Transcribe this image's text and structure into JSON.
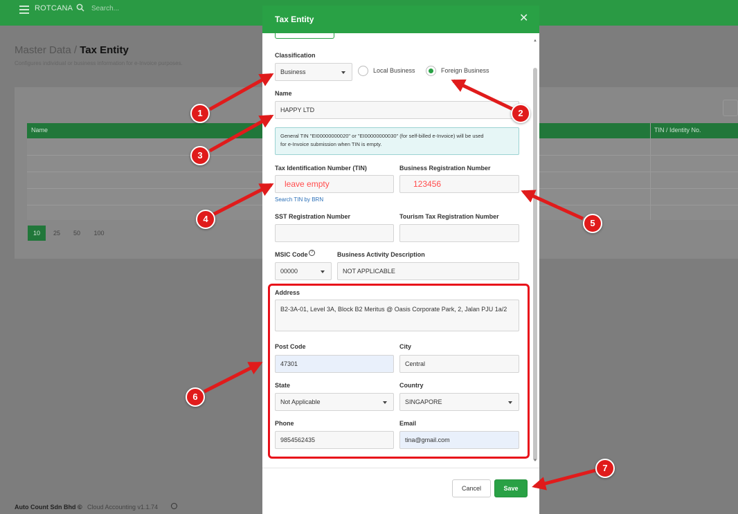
{
  "app": {
    "brand": "ROTCANA",
    "search_placeholder": "Search..."
  },
  "page": {
    "breadcrumb_parent": "Master Data",
    "breadcrumb_separator": " / ",
    "title": "Tax Entity",
    "subtitle": "Configures individual or business information for e-Invoice purposes."
  },
  "table": {
    "columns": [
      "Name",
      "TIN / Identity No."
    ],
    "page_sizes": [
      "10",
      "25",
      "50",
      "100"
    ],
    "active_page_size": "10"
  },
  "footer": {
    "company": "Auto Count Sdn Bhd",
    "copyright": "©",
    "version": "Cloud Accounting v1.1.74"
  },
  "modal": {
    "title": "Tax Entity",
    "classification": {
      "label": "Classification",
      "value": "Business",
      "options": [
        {
          "label": "Local Business",
          "selected": false
        },
        {
          "label": "Foreign Business",
          "selected": true
        }
      ]
    },
    "name": {
      "label": "Name",
      "value": "HAPPY LTD"
    },
    "info_line1": "General TIN \"EI00000000020\" or \"EI00000000030\" (for self-billed e-Invoice) will be used",
    "info_line2": "for e-Invoice submission when TIN is empty.",
    "tin": {
      "label": "Tax Identification Number (TIN)",
      "value": "leave empty",
      "link": "Search TIN by BRN"
    },
    "brn": {
      "label": "Business Registration Number",
      "value": "123456"
    },
    "sst": {
      "label": "SST Registration Number",
      "value": ""
    },
    "tourism": {
      "label": "Tourism Tax Registration Number",
      "value": ""
    },
    "msic": {
      "label": "MSIC Code",
      "value": "00000",
      "help": "?"
    },
    "activity": {
      "label": "Business Activity Description",
      "value": "NOT APPLICABLE"
    },
    "address": {
      "label": "Address",
      "value": "B2-3A-01, Level 3A, Block B2 Meritus @ Oasis Corporate Park, 2, Jalan PJU 1a/2"
    },
    "postcode": {
      "label": "Post Code",
      "value": "47301"
    },
    "city": {
      "label": "City",
      "value": "Central"
    },
    "state": {
      "label": "State",
      "value": "Not Applicable"
    },
    "country": {
      "label": "Country",
      "value": "SINGAPORE"
    },
    "phone": {
      "label": "Phone",
      "value": "9854562435"
    },
    "email": {
      "label": "Email",
      "value": "tina@gmail.com"
    },
    "cancel_label": "Cancel",
    "save_label": "Save",
    "close_glyph": "✕"
  },
  "annotations": {
    "color": "#e01b1b",
    "badges": [
      "1",
      "2",
      "3",
      "4",
      "5",
      "6",
      "7"
    ]
  }
}
